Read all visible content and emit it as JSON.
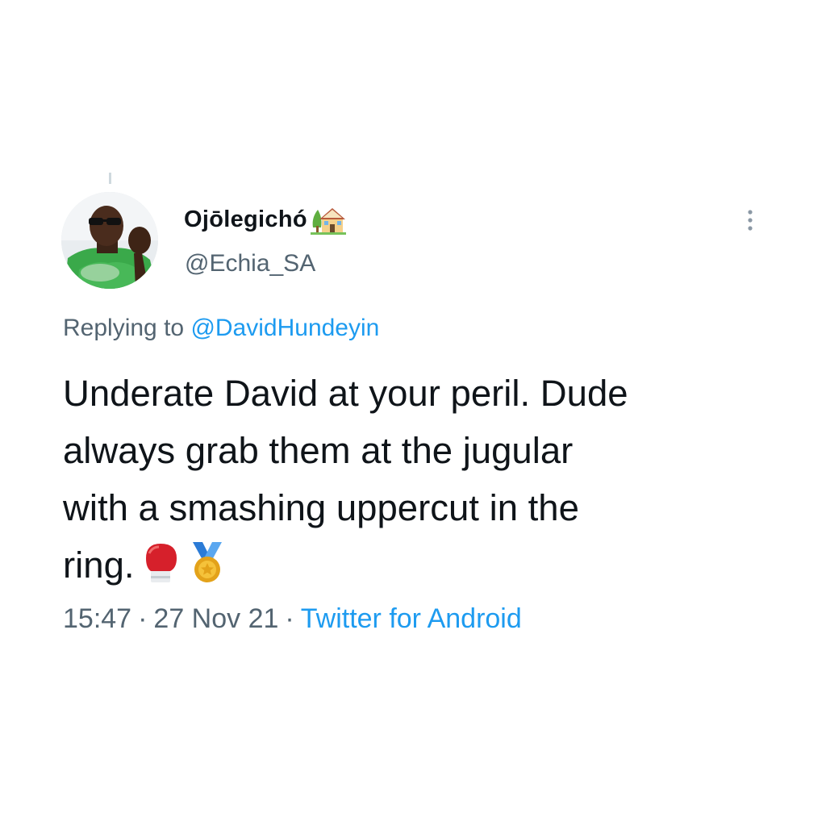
{
  "tweet": {
    "author": {
      "display_name": "Ojōlegichó",
      "name_emoji": "house-with-garden-icon",
      "handle": "@Echia_SA",
      "avatar": "profile-photo"
    },
    "reply": {
      "prefix": "Replying to",
      "mention": "@DavidHundeyin"
    },
    "text_lines": [
      "Underate David at your peril. Dude",
      "always grab them at the jugular",
      "with a smashing uppercut in the",
      "ring."
    ],
    "text_emojis": [
      "boxing-glove-icon",
      "sports-medal-icon"
    ],
    "time": "15:47",
    "date": "27 Nov 21",
    "source": "Twitter for Android",
    "separator": "·"
  },
  "colors": {
    "text_primary": "#0f1419",
    "text_secondary": "#536471",
    "link": "#1d9bf0",
    "background": "#ffffff"
  }
}
